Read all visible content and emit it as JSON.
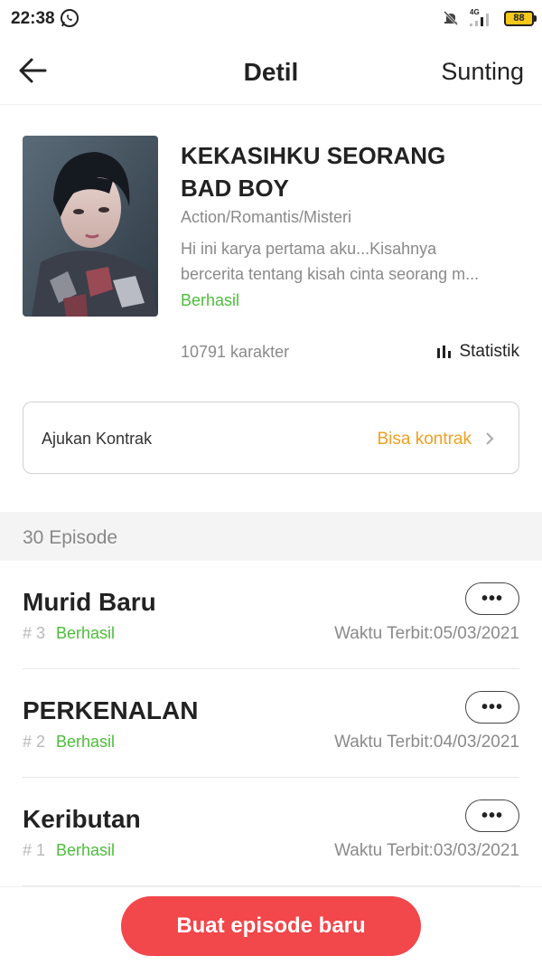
{
  "status_bar": {
    "time": "22:38",
    "network": "4G",
    "battery": "88",
    "icons": [
      "whatsapp-icon",
      "mute-icon",
      "signal-icon",
      "battery-icon"
    ]
  },
  "header": {
    "title": "Detil",
    "edit_label": "Sunting",
    "back_icon": "arrow-left-icon"
  },
  "book": {
    "title": "KEKASIHKU SEORANG BAD BOY",
    "genres": "Action/Romantis/Misteri",
    "description_line1": "Hi ini karya pertama aku...Kisahnya",
    "description_line2": "bercerita tentang kisah cinta seorang m...",
    "status": "Berhasil",
    "char_count": "10791 karakter",
    "stats_label": "Statistik"
  },
  "contract": {
    "label": "Ajukan Kontrak",
    "status": "Bisa kontrak"
  },
  "episodes_header": "30 Episode",
  "episodes": [
    {
      "title": "Murid Baru",
      "number": "# 3",
      "status": "Berhasil",
      "published": "Waktu Terbit:05/03/2021",
      "more": "•••"
    },
    {
      "title": "PERKENALAN",
      "number": "# 2",
      "status": "Berhasil",
      "published": "Waktu Terbit:04/03/2021",
      "more": "•••"
    },
    {
      "title": "Keributan",
      "number": "# 1",
      "status": "Berhasil",
      "published": "Waktu Terbit:03/03/2021",
      "more": "•••"
    }
  ],
  "create_button": "Buat episode baru",
  "colors": {
    "success": "#4dbd3b",
    "contract_status": "#f0a020",
    "primary_button": "#f2474b",
    "muted_text": "#8a8a8a"
  }
}
